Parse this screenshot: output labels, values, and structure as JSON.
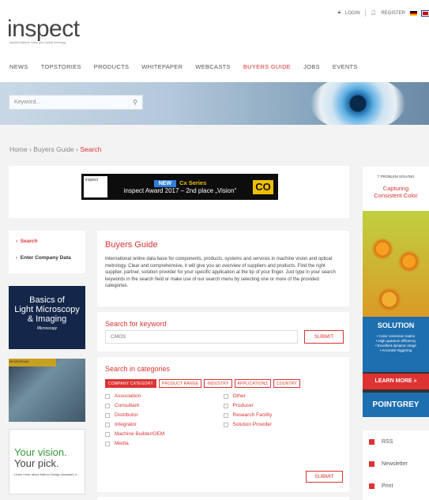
{
  "header": {
    "logo": "inspect",
    "logo_subtitle": "Applied Machine Vision and Optical Metrology",
    "login": "LOGIN",
    "register": "REGISTER"
  },
  "nav": {
    "items": [
      "NEWS",
      "TOPSTORIES",
      "PRODUCTS",
      "WHITEPAPER",
      "WEBCASTS",
      "BUYERS GUIDE",
      "JOBS",
      "EVENTS"
    ],
    "active": "BUYERS GUIDE"
  },
  "search": {
    "placeholder": "Keyword..."
  },
  "breadcrumb": {
    "home": "Home",
    "buyers": "Buyers Guide",
    "current": "Search",
    "sep": "›"
  },
  "ad_top": {
    "brand": "inspect",
    "new": "NEW",
    "series": "Cx Series",
    "award": "inspect Award 2017 – 2nd place „Vision“",
    "mark": "CO"
  },
  "left_menu": {
    "search": "Search",
    "enter": "Enter Company Data"
  },
  "left_ads": {
    "ad1_line1": "Basics of",
    "ad1_line2": "Light Microscopy",
    "ad1_line3": "& Imaging",
    "ad1_sub": "Microscopy",
    "ad2_tag": "MICROSCAN",
    "ad3_line1": "Your vision.",
    "ad3_line2": "Your pick.",
    "ad3_sub": "Learn more about Matrox Design Assistant 4..."
  },
  "buyers_guide": {
    "title": "Buyers Guide",
    "intro": "International online data base for components, products, systems and services in machine vision and optical metrology. Clear and comprehensive, it will give you an overview of suppliers and products. Find the right supplier, partner, solution provider for your specific application at the tip of your finger. Just type in your search keywords in the search field or make use of our search menu by selecting one or more of the provided categories."
  },
  "keyword_search": {
    "label": "Search for keyword",
    "value": "CMOS",
    "submit": "SUBMIT"
  },
  "category_search": {
    "label": "Search in categories",
    "tabs": [
      "COMPANY CATEGORY",
      "PRODUCT RANGE",
      "INDUSTRY",
      "APPLICATIONS",
      "COUNTRY"
    ],
    "col1": [
      "Association",
      "Consultant",
      "Distributor",
      "Integrator",
      "Machine Builder/OEM",
      "Media"
    ],
    "col2": [
      "Other",
      "Producer",
      "Research Facility",
      "Solution Provider"
    ],
    "submit": "SUBMIT"
  },
  "right_ad": {
    "tag": "PROBLEM SOLVING",
    "headline1": "Capturing",
    "headline2": "Consistent Color",
    "solution": "SOLUTION",
    "features": [
      "• Color correction matrix",
      "• High quantum efficiency",
      "• Excellent dynamic range",
      "• Accurate triggering"
    ],
    "cta": "LEARN MORE »",
    "brand": "POINTGREY"
  },
  "share": {
    "rss": "RSS",
    "newsletter": "Newsletter",
    "print": "Print"
  }
}
